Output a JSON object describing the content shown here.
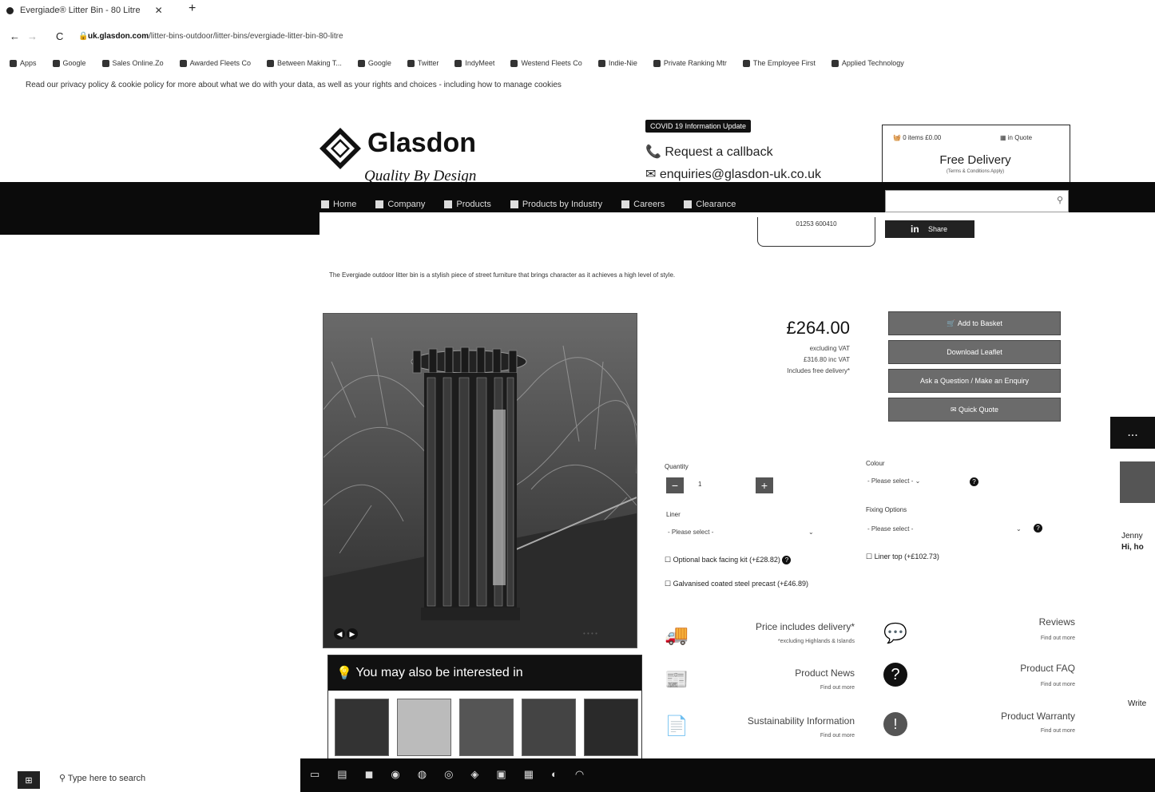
{
  "browser": {
    "tab_title": "Evergiade® Litter Bin - 80 Litre",
    "tab_close": "✕",
    "new_tab": "+",
    "url_domain": "uk.glasdon.com",
    "url_path": "/litter-bins-outdoor/litter-bins/evergiade-litter-bin-80-litre",
    "bookmarks": [
      "Apps",
      "Google",
      "Sales Online.Zo",
      "Awarded Fleets Co",
      "Between Making T...",
      "Google",
      "Twitter",
      "IndyMeet",
      "Westend Fleets Co",
      "Indie-Nie",
      "Private Ranking Mtr",
      "The Employee First",
      "Applied Technology"
    ]
  },
  "cookie_notice": "Read our privacy policy & cookie policy for more about what we do with your data, as well as your rights and choices - including how to manage cookies",
  "header": {
    "brand": "Glasdon",
    "tagline": "Quality By Design",
    "covid_badge": "COVID 19 Information Update",
    "callback": "Request a callback",
    "email": "enquiries@glasdon-uk.co.uk",
    "basket": "0 items £0.00",
    "quote": "in Quote",
    "free_delivery": "Free Delivery",
    "delivery_terms": "(Terms & Conditions Apply)"
  },
  "nav": {
    "items": [
      "Home",
      "Company",
      "Products",
      "Products by Industry",
      "Careers",
      "Clearance"
    ],
    "phone": "01253 600410",
    "linkedin": "Share"
  },
  "intro": "The Evergiade outdoor litter bin is a stylish piece of street furniture that brings character as it achieves a high level of style.",
  "product": {
    "price": "£264.00",
    "ex_vat": "excluding VAT",
    "inc_vat": "£316.80 inc VAT",
    "delivery_note": "Includes free delivery*",
    "buttons": [
      "Add to Basket",
      "Download Leaflet",
      "Ask a Question / Make an Enquiry",
      "Quick Quote"
    ],
    "quantity_label": "Quantity",
    "quantity_value": "1",
    "colour_label": "Colour",
    "colour_value": "- Please select -",
    "liner_label": "Liner",
    "liner_value": "- Please select -",
    "fixing_label": "Fixing Options",
    "fixing_value": "- Please select -",
    "option1": "Optional back facing kit (+£28.82)",
    "option2": "Liner top (+£102.73)",
    "option3": "Galvanised coated steel precast (+£46.89)"
  },
  "info": {
    "delivery_title": "Price includes delivery*",
    "delivery_sub": "*excluding Highlands & Islands",
    "reviews_title": "Reviews",
    "reviews_sub": "Find out more",
    "news_title": "Product News",
    "news_sub": "Find out more",
    "faq_title": "Product FAQ",
    "faq_sub": "Find out more",
    "sustain_title": "Sustainability Information",
    "sustain_sub": "Find out more",
    "warranty_title": "Product Warranty",
    "warranty_sub": "Find out more"
  },
  "interested": "You may also be interested in",
  "side": {
    "chat": "...",
    "name": "Jenny",
    "greet": "Hi, ho",
    "write": "Write"
  },
  "taskbar": {
    "search": "Type here to search"
  }
}
